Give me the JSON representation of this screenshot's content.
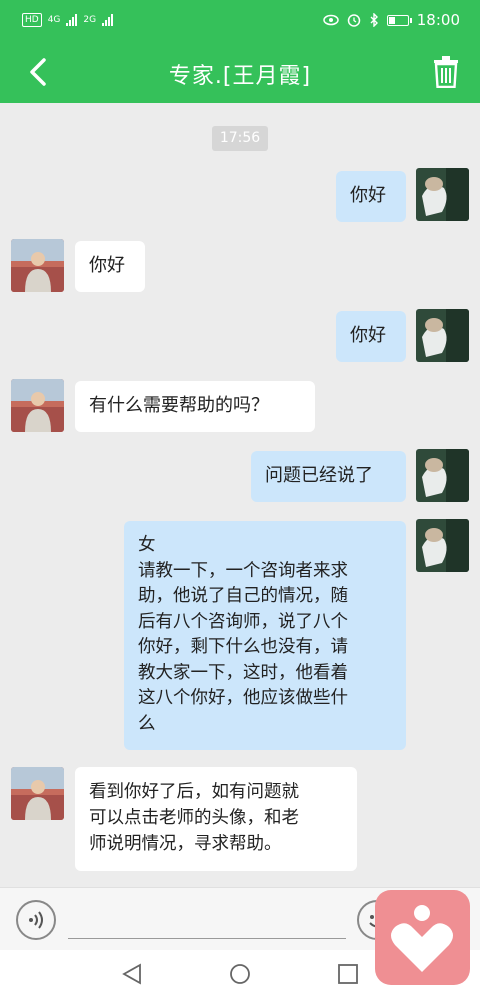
{
  "status_bar": {
    "left": {
      "hd": "HD",
      "net1": "4G",
      "net2": "2G"
    },
    "time": "18:00",
    "icons": [
      "eye-icon",
      "alarm-icon",
      "bluetooth-icon",
      "battery-icon"
    ]
  },
  "header": {
    "title": "专家.[王月霞]",
    "back_icon": "back-arrow-icon",
    "delete_icon": "trash-icon"
  },
  "chat": {
    "timestamp": "17:56",
    "messages": [
      {
        "from": "me",
        "text": "你好"
      },
      {
        "from": "expert",
        "text": "你好"
      },
      {
        "from": "me",
        "text": "你好"
      },
      {
        "from": "expert",
        "text": "有什么需要帮助的吗？"
      },
      {
        "from": "me",
        "text": "问题已经说了"
      },
      {
        "from": "me",
        "text": "女\n请教一下，一个咨询者来求\n助，他说了自己的情况，随\n后有八个咨询师，说了八个\n你好，剩下什么也没有，请\n教大家一下，这时，他看着\n这八个你好，他应该做些什\n么"
      },
      {
        "from": "expert",
        "text": "看到你好了后，如有问题就\n可以点击老师的头像，和老\n师说明情况，寻求帮助。"
      }
    ]
  },
  "input_bar": {
    "voice_icon": "voice-icon",
    "emoji_icon": "emoji-icon"
  },
  "nav_bar": {
    "back": "nav-back-icon",
    "home": "nav-home-icon",
    "recents": "nav-recents-icon"
  },
  "colors": {
    "accent": "#35c15a",
    "outgoing_bubble": "#cce6fb",
    "incoming_bubble": "#ffffff",
    "badge": "#ef8f93"
  }
}
